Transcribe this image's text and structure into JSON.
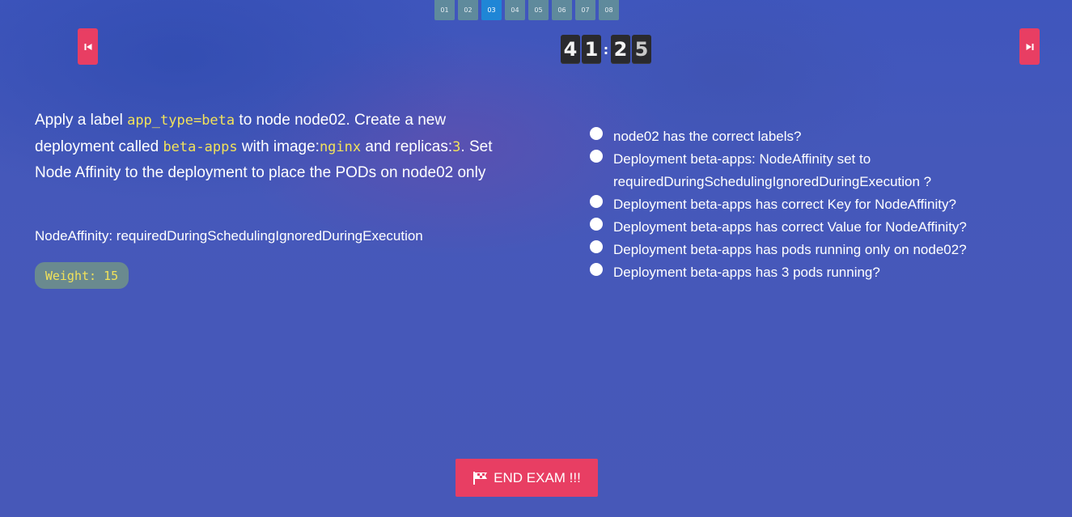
{
  "question_nav": [
    {
      "label": "01",
      "active": false
    },
    {
      "label": "02",
      "active": false
    },
    {
      "label": "03",
      "active": true
    },
    {
      "label": "04",
      "active": false
    },
    {
      "label": "05",
      "active": false
    },
    {
      "label": "06",
      "active": false
    },
    {
      "label": "07",
      "active": false
    },
    {
      "label": "08",
      "active": false
    }
  ],
  "timer": {
    "digits": [
      "4",
      "1",
      "2",
      "5"
    ],
    "separator": ":"
  },
  "question": {
    "t1": "Apply a label ",
    "c1": "app_type=beta",
    "t2": " to node node02. Create a new deployment called ",
    "c2": "beta-apps",
    "t3": " with image:",
    "c3": "nginx",
    "t4": " and replicas:",
    "c4": "3",
    "t5": ". Set Node Affinity to the deployment to place the PODs on node02 only"
  },
  "affinity_text": "NodeAffinity: requiredDuringSchedulingIgnoredDuringExecution",
  "weight_label": "Weight: 15",
  "checklist": [
    "node02 has the correct labels?",
    "Deployment beta-apps: NodeAffinity set to requiredDuringSchedulingIgnoredDuringExecution ?",
    "Deployment beta-apps has correct Key for NodeAffinity?",
    "Deployment beta-apps has correct Value for NodeAffinity?",
    "Deployment beta-apps has pods running only on node02?",
    "Deployment beta-apps has 3 pods running?"
  ],
  "end_exam_label": "END EXAM !!!",
  "colors": {
    "accent": "#e83e63",
    "code": "#f2e25a",
    "active_tab": "#1f86d6",
    "tab": "#5f8a9c"
  },
  "icons": {
    "prev": "skip-previous-icon",
    "next": "skip-next-icon",
    "end": "flag-icon"
  }
}
